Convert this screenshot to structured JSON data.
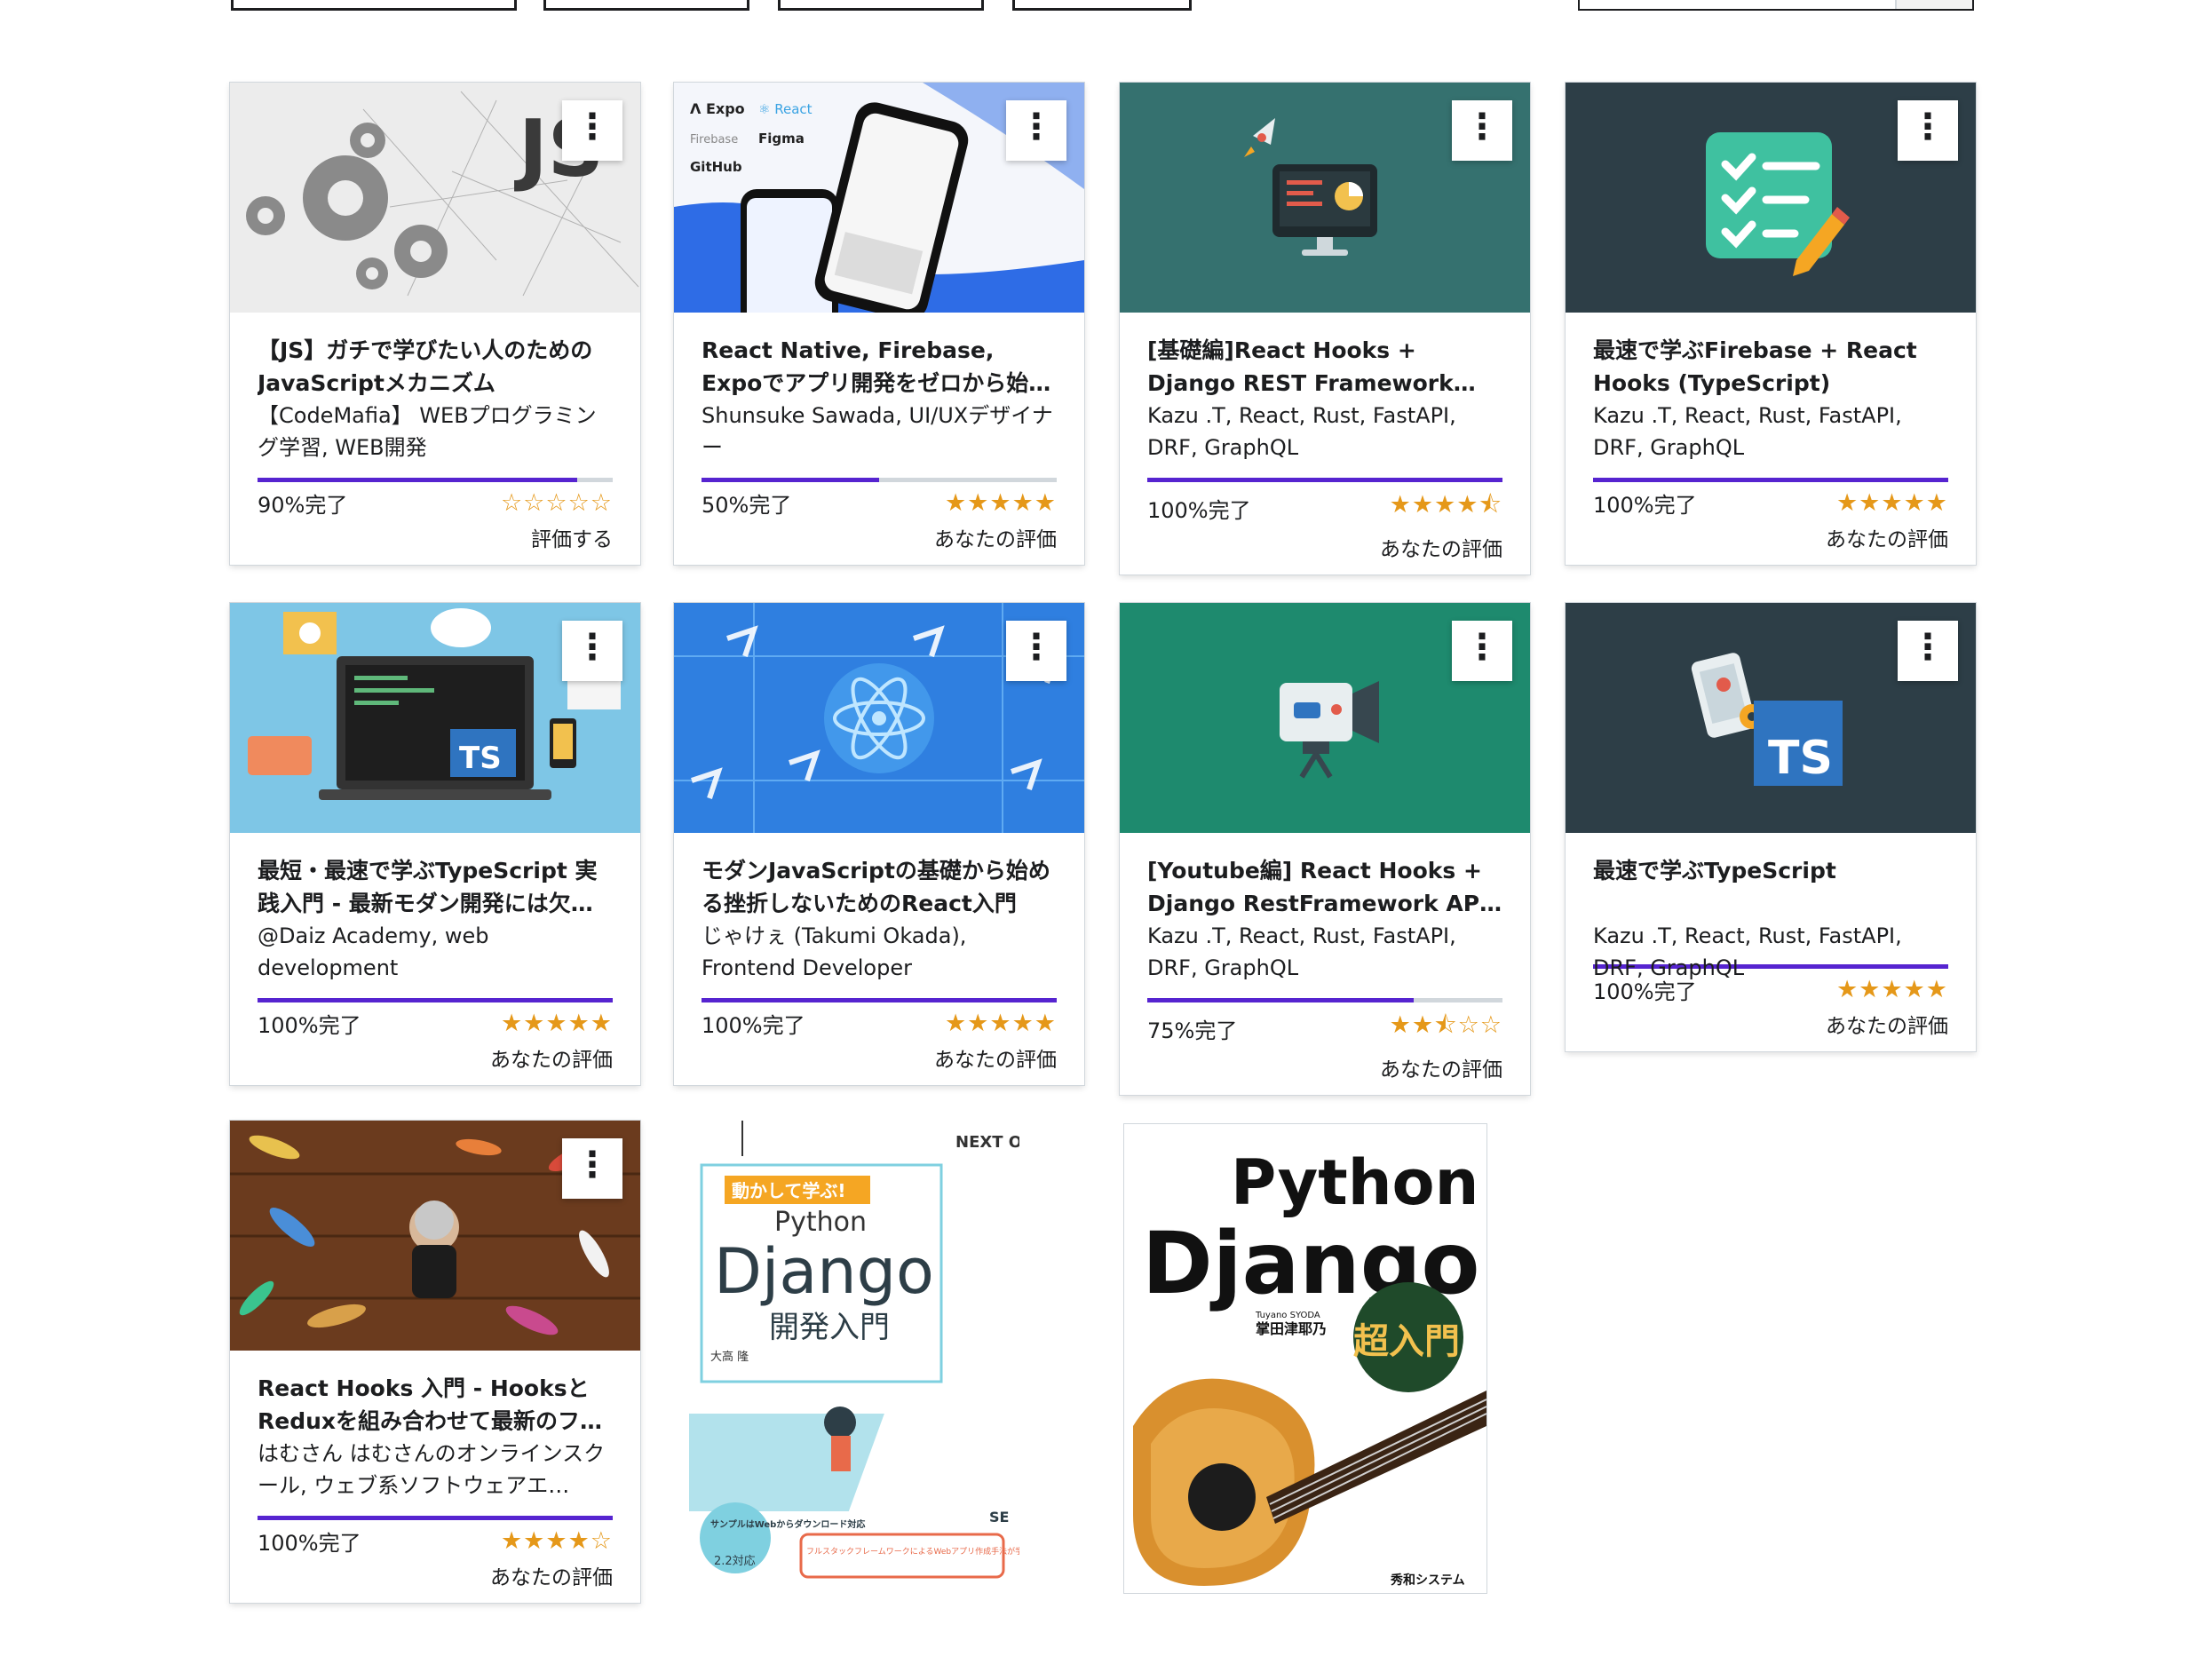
{
  "courses": [
    {
      "title": "【JS】ガチで学びたい人のためのJavaScriptメカニズム",
      "author": "【CodeMafia】 WEBプログラミング学習, WEB開発",
      "progress_label": "90%完了",
      "progress": 0.9,
      "stars": "☆☆☆☆☆",
      "rating": 0,
      "rating_label": "評価する",
      "image_icon": "js-gears-image"
    },
    {
      "title": "React Native, Firebase, Expoでアプリ開発をゼロから始めよ…",
      "author": "Shunsuke Sawada, UI/UXデザイナー",
      "progress_label": "50%完了",
      "progress": 0.5,
      "stars": "★★★★★",
      "rating": 5,
      "rating_label": "あなたの評価",
      "image_icon": "phone-app-image"
    },
    {
      "title": "[基礎編]React Hooks + Django REST Framework API でフル…",
      "author": "Kazu .T, React, Rust, FastAPI, DRF, GraphQL",
      "progress_label": "100%完了",
      "progress": 1.0,
      "stars": "★★★★⯪",
      "rating": 4.5,
      "rating_label": "あなたの評価",
      "image_icon": "monitor-rocket-image"
    },
    {
      "title": "最速で学ぶFirebase + React Hooks (TypeScript)",
      "author": "Kazu .T, React, Rust, FastAPI, DRF, GraphQL",
      "progress_label": "100%完了",
      "progress": 1.0,
      "stars": "★★★★★",
      "rating": 5,
      "rating_label": "あなたの評価",
      "image_icon": "checklist-image"
    },
    {
      "title": "最短・最速で学ぶTypeScript 実践入門 - 最新モダン開発には欠…",
      "author": "@Daiz Academy, web development",
      "progress_label": "100%完了",
      "progress": 1.0,
      "stars": "★★★★★",
      "rating": 5,
      "rating_label": "あなたの評価",
      "image_icon": "laptop-ts-image"
    },
    {
      "title": "モダンJavaScriptの基礎から始める挫折しないためのReact入門",
      "author": "じゃけぇ (Takumi Okada), Frontend Developer",
      "progress_label": "100%完了",
      "progress": 1.0,
      "stars": "★★★★★",
      "rating": 5,
      "rating_label": "あなたの評価",
      "image_icon": "react-atom-image"
    },
    {
      "title": "[Youtube編] React Hooks + Django RestFramework API …",
      "author": "Kazu .T, React, Rust, FastAPI, DRF, GraphQL",
      "progress_label": "75%完了",
      "progress": 0.75,
      "stars": "★★⯪☆☆",
      "rating": 2.5,
      "rating_label": "あなたの評価",
      "image_icon": "camera-image"
    },
    {
      "title": "最速で学ぶTypeScript",
      "author": "Kazu .T, React, Rust, FastAPI, DRF, GraphQL",
      "progress_label": "100%完了",
      "progress": 1.0,
      "stars": "★★★★★",
      "rating": 5,
      "rating_label": "あなたの評価",
      "image_icon": "ts-badge-image"
    },
    {
      "title": "React Hooks 入門 - HooksとReduxを組み合わせて最新のフ…",
      "author": "はむさん はむさんのオンラインスクール, ウェブ系ソフトウェアエ…",
      "progress_label": "100%完了",
      "progress": 1.0,
      "stars": "★★★★☆",
      "rating": 4,
      "rating_label": "あなたの評価",
      "image_icon": "fishing-lures-image"
    }
  ],
  "books": [
    {
      "badge": "動かして学ぶ!",
      "lang": "Python",
      "title": "Django",
      "subtitle": "開発入門",
      "author": "大高 隆",
      "series": "NEXT ONE",
      "bubble": "サンプルはWebからダウンロード対応",
      "version": "2.2対応",
      "banner": "フルスタックフレームワークによるWebアプリ作成手法が学べる!",
      "publisher": "SE"
    },
    {
      "line1": "Python",
      "line2": "Django",
      "badge": "超入門",
      "author_en": "Tuyano SYODA",
      "author": "掌田津耶乃",
      "publisher": "秀和システム"
    }
  ],
  "colors": {
    "accent": "#5624d0",
    "star": "#e59819",
    "teal": "#35716f",
    "slate": "#2d3e47",
    "green": "#1e8a6e",
    "blue": "#2f7fe0"
  }
}
